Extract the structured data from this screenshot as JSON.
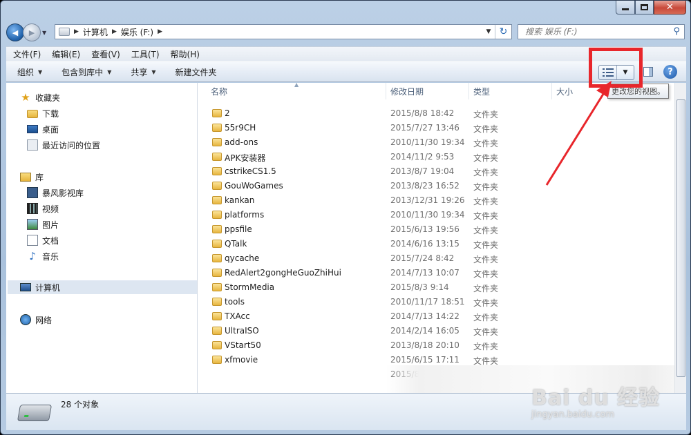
{
  "window": {
    "caption": {
      "minimize": "–",
      "maximize": "□",
      "close": "✕"
    }
  },
  "nav": {
    "back_glyph": "◀",
    "forward_glyph": "▶",
    "history_drop": "▼",
    "breadcrumbs": [
      "计算机",
      "娱乐 (F:)"
    ],
    "crumb_sep": "▶",
    "address_drop": "▼",
    "refresh_glyph": "↻",
    "search_placeholder": "搜索 娱乐 (F:)",
    "search_icon": "magnifier-icon"
  },
  "menu": {
    "items": [
      "文件(F)",
      "编辑(E)",
      "查看(V)",
      "工具(T)",
      "帮助(H)"
    ]
  },
  "toolbar": {
    "organize": "组织",
    "include_library": "包含到库中",
    "share": "共享",
    "new_folder": "新建文件夹",
    "drop_arrow": "▼",
    "view_drop": "▼",
    "help": "?",
    "tooltip": "更改您的视图。"
  },
  "sidebar": {
    "favorites": {
      "title": "收藏夹",
      "items": [
        "下载",
        "桌面",
        "最近访问的位置"
      ]
    },
    "libraries": {
      "title": "库",
      "items": [
        "暴风影视库",
        "视频",
        "图片",
        "文档",
        "音乐"
      ]
    },
    "computer": "计算机",
    "network": "网络",
    "star_glyph": "★",
    "music_glyph": "♪"
  },
  "columns": {
    "name": "名称",
    "date": "修改日期",
    "type": "类型",
    "size": "大小",
    "sort_caret": "▲"
  },
  "files": [
    {
      "name": "2",
      "date": "2015/8/8 18:42",
      "type": "文件夹"
    },
    {
      "name": "55r9CH",
      "date": "2015/7/27 13:46",
      "type": "文件夹"
    },
    {
      "name": "add-ons",
      "date": "2010/11/30 19:34",
      "type": "文件夹"
    },
    {
      "name": "APK安装器",
      "date": "2014/11/2 9:53",
      "type": "文件夹"
    },
    {
      "name": "cstrikeCS1.5",
      "date": "2013/8/7 19:04",
      "type": "文件夹"
    },
    {
      "name": "GouWoGames",
      "date": "2013/8/23 16:52",
      "type": "文件夹"
    },
    {
      "name": "kankan",
      "date": "2013/12/31 19:26",
      "type": "文件夹"
    },
    {
      "name": "platforms",
      "date": "2010/11/30 19:34",
      "type": "文件夹"
    },
    {
      "name": "ppsfile",
      "date": "2015/6/13 19:56",
      "type": "文件夹"
    },
    {
      "name": "QTalk",
      "date": "2014/6/16 13:15",
      "type": "文件夹"
    },
    {
      "name": "qycache",
      "date": "2015/7/24 8:42",
      "type": "文件夹"
    },
    {
      "name": "RedAlert2gongHeGuoZhiHui",
      "date": "2014/7/13 10:07",
      "type": "文件夹"
    },
    {
      "name": "StormMedia",
      "date": "2015/8/3 9:14",
      "type": "文件夹"
    },
    {
      "name": "tools",
      "date": "2010/11/17 18:51",
      "type": "文件夹"
    },
    {
      "name": "TXAcc",
      "date": "2014/7/13 14:22",
      "type": "文件夹"
    },
    {
      "name": "UltraISO",
      "date": "2014/2/14 16:05",
      "type": "文件夹"
    },
    {
      "name": "VStart50",
      "date": "2013/8/18 20:10",
      "type": "文件夹"
    },
    {
      "name": "xfmovie",
      "date": "2015/6/15 17:11",
      "type": "文件夹"
    },
    {
      "name": "",
      "date": "2015/8/14 8:0",
      "type": ""
    }
  ],
  "status": {
    "count": "28 个对象"
  },
  "watermark": {
    "main": "Bai du 经验",
    "sub": "jingyan.baidu.com"
  },
  "colors": {
    "highlight": "#e8262b",
    "accent": "#1d5fa8"
  }
}
